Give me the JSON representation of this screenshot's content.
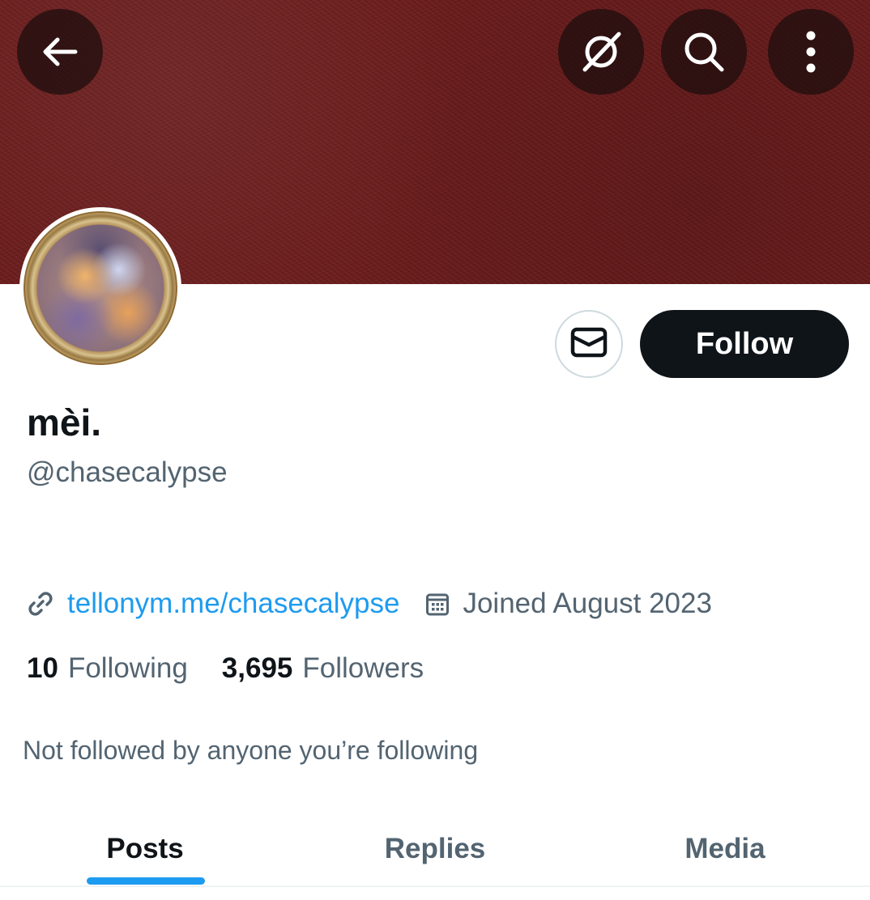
{
  "header": {
    "icons": {
      "back": "arrow-left-icon",
      "grok": "grok-icon",
      "search": "search-icon",
      "more": "more-vertical-icon"
    }
  },
  "profile": {
    "display_name": "mèi.",
    "handle": "@chasecalypse",
    "link": "tellonym.me/chasecalypse",
    "joined": "Joined August 2023",
    "following_count": "10",
    "following_label": "Following",
    "followers_count": "3,695",
    "followers_label": "Followers",
    "followed_by_text": "Not followed by anyone you’re following"
  },
  "actions": {
    "follow_label": "Follow",
    "message_icon": "envelope-icon"
  },
  "tabs": [
    {
      "label": "Posts",
      "active": true
    },
    {
      "label": "Replies",
      "active": false
    },
    {
      "label": "Media",
      "active": false
    }
  ],
  "colors": {
    "banner": "#6a1a1a",
    "accent": "#1d9bf0",
    "primary_text": "#0f1419",
    "secondary_text": "#536471"
  }
}
